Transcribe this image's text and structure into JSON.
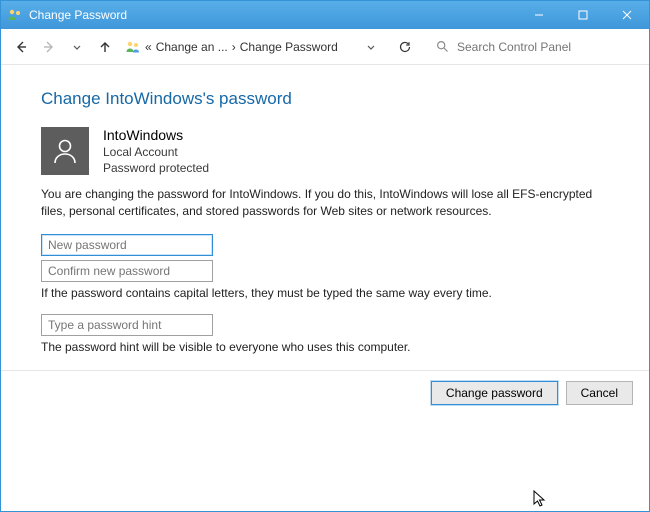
{
  "titlebar": {
    "title": "Change Password"
  },
  "breadcrumb": {
    "level1": "Change an ...",
    "level2": "Change Password"
  },
  "search": {
    "placeholder": "Search Control Panel"
  },
  "page": {
    "heading": "Change IntoWindows's password",
    "user": {
      "name": "IntoWindows",
      "type": "Local Account",
      "status": "Password protected"
    },
    "warning": "You are changing the password for IntoWindows.  If you do this, IntoWindows will lose all EFS-encrypted files, personal certificates, and stored passwords for Web sites or network resources.",
    "new_password_placeholder": "New password",
    "confirm_password_placeholder": "Confirm new password",
    "caps_note": "If the password contains capital letters, they must be typed the same way every time.",
    "hint_placeholder": "Type a password hint",
    "hint_note": "The password hint will be visible to everyone who uses this computer."
  },
  "buttons": {
    "change": "Change password",
    "cancel": "Cancel"
  }
}
